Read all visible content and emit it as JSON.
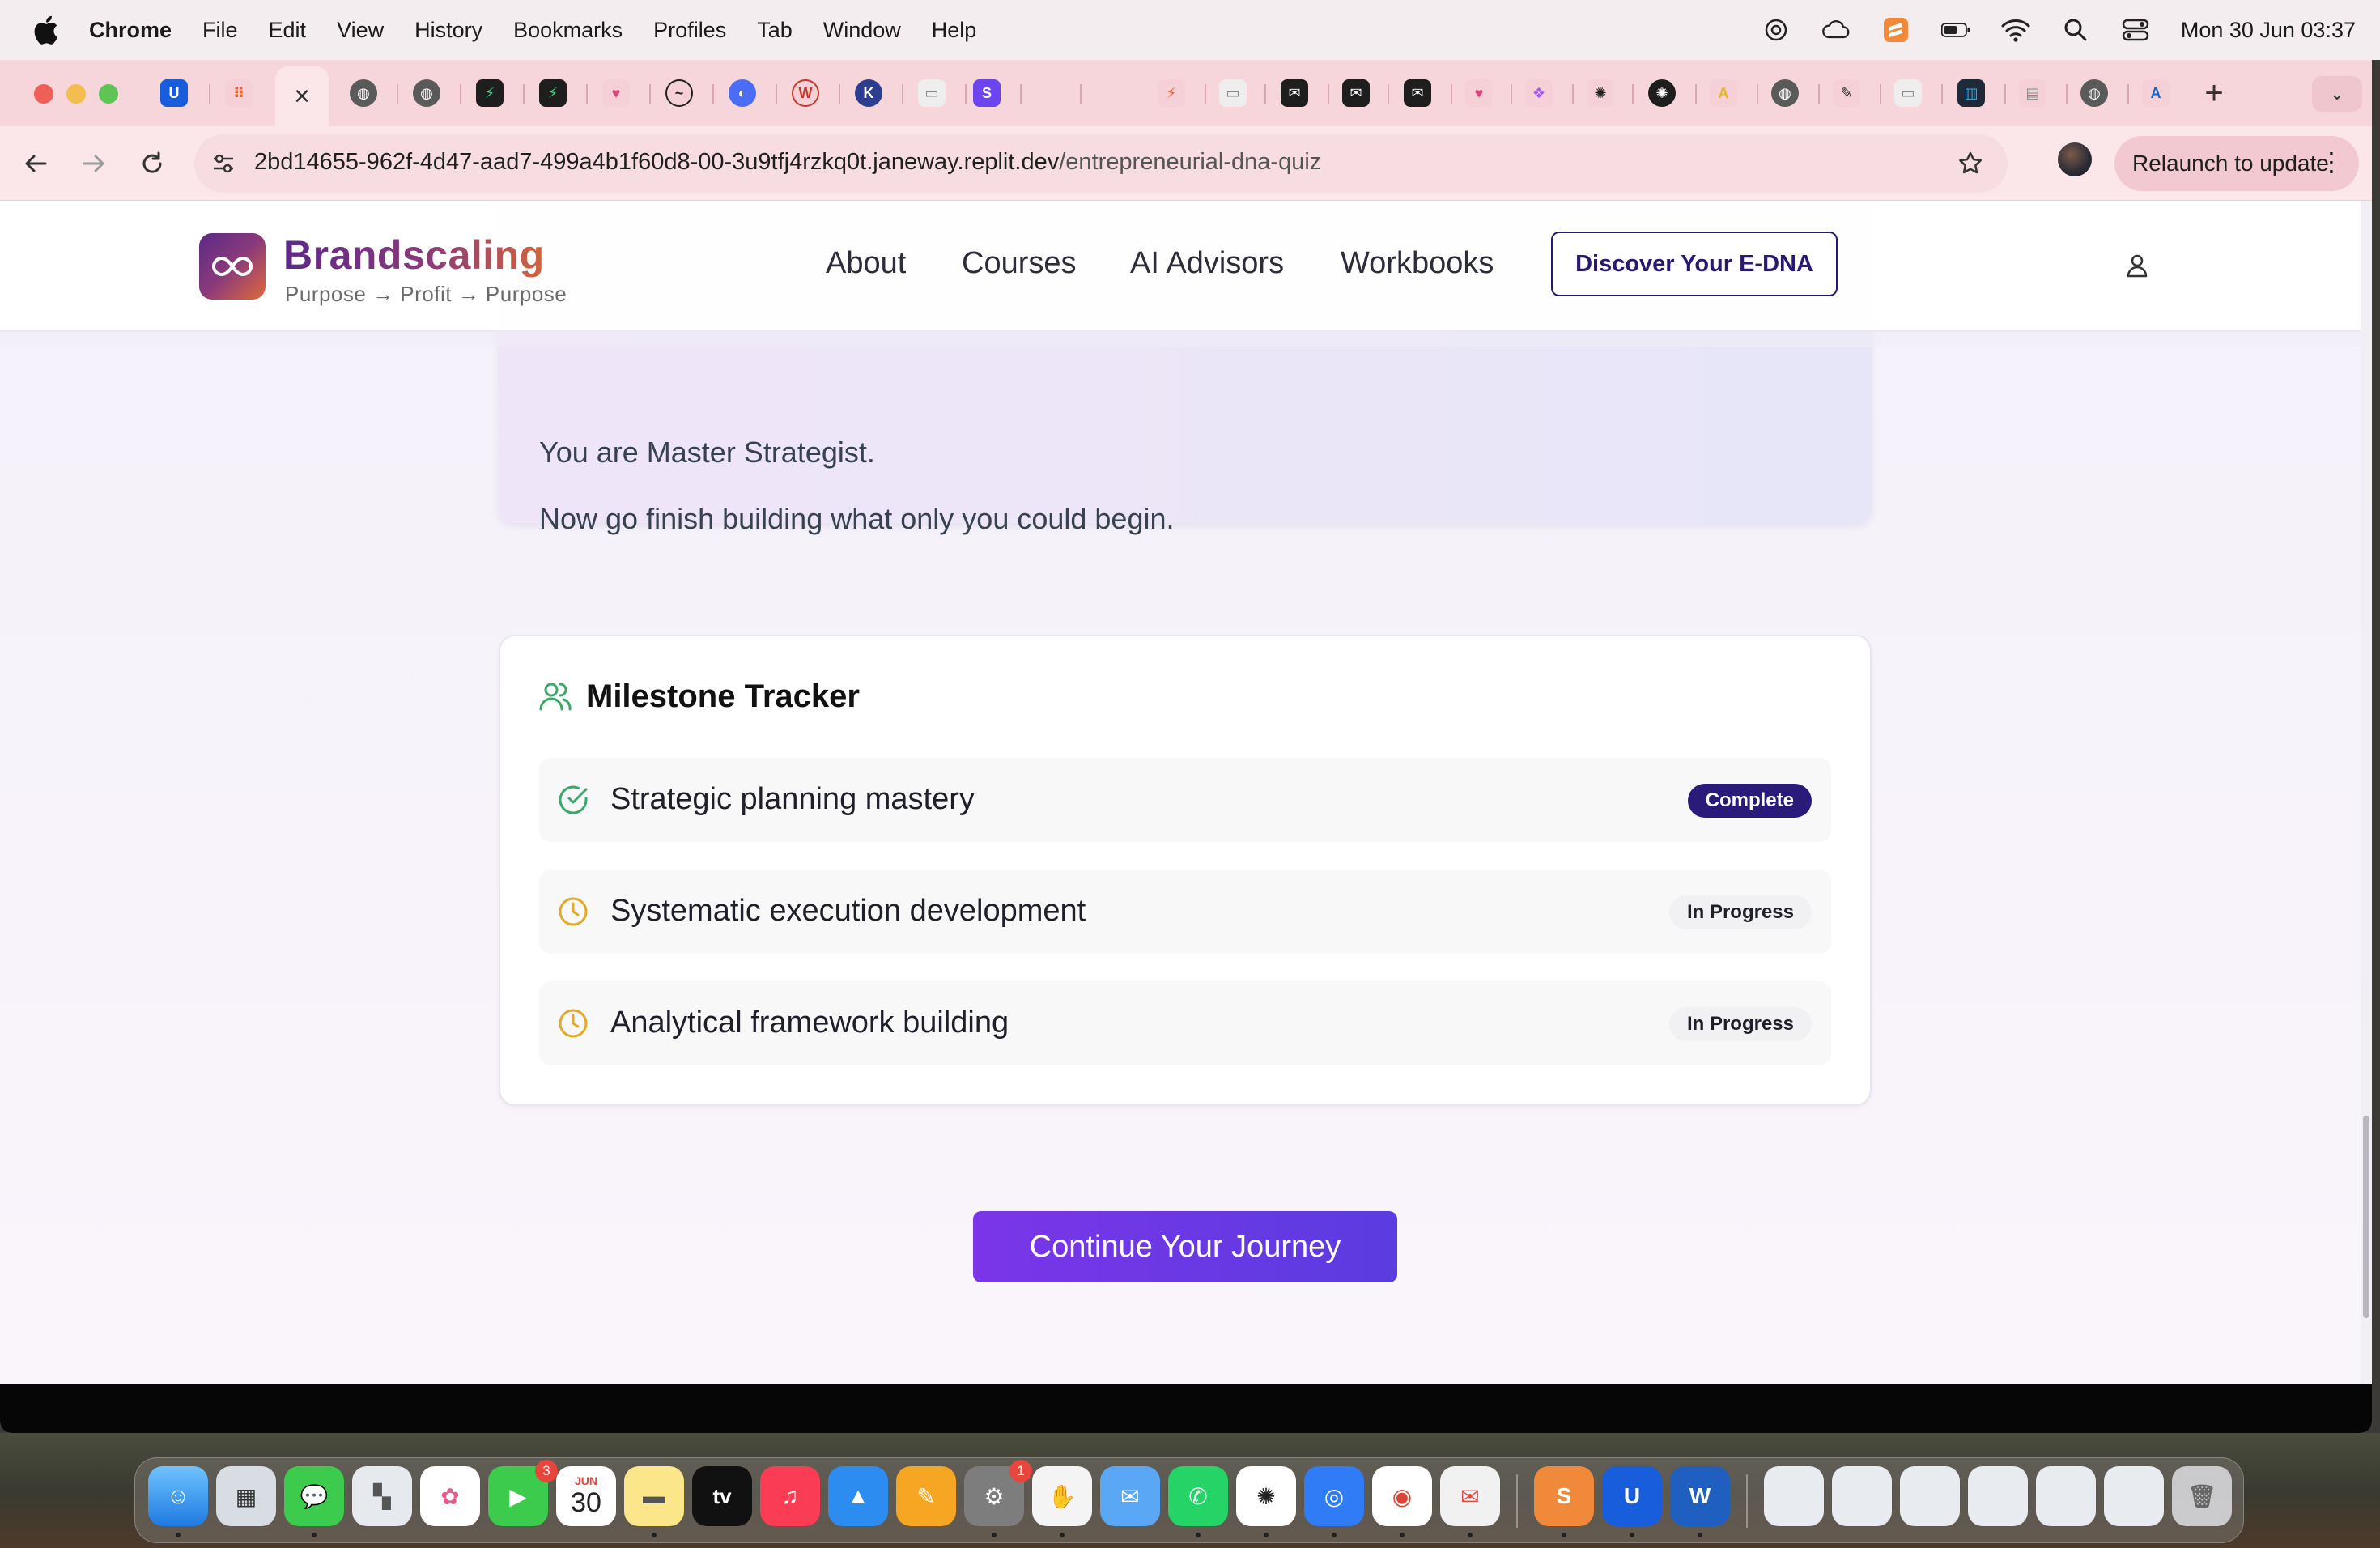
{
  "menubar": {
    "app_name": "Chrome",
    "items": [
      "File",
      "Edit",
      "View",
      "History",
      "Bookmarks",
      "Profiles",
      "Tab",
      "Window",
      "Help"
    ],
    "clock": "Mon 30 Jun  03:37"
  },
  "browser": {
    "url_host": "2bd14655-962f-4d47-aad7-499a4b1f60d8-00-3u9tfj4rzkq0t.janeway.replit.dev",
    "url_path": "/entrepreneurial-dna-quiz",
    "relaunch_label": "Relaunch to update",
    "new_tab_label": "+",
    "close_tab_label": "×"
  },
  "header": {
    "brand_name": "Brandscaling",
    "tagline": "Purpose → Profit → Purpose",
    "nav": {
      "about": "About",
      "courses": "Courses",
      "ai_advisors": "AI Advisors",
      "workbooks": "Workbooks"
    },
    "cta_label": "Discover Your E-DNA"
  },
  "result_card": {
    "line1": "You are Master Strategist.",
    "line2": "Now go finish building what only you could begin."
  },
  "milestones": {
    "title": "Milestone Tracker",
    "items": [
      {
        "label": "Strategic planning mastery",
        "status": "Complete"
      },
      {
        "label": "Systematic execution development",
        "status": "In Progress"
      },
      {
        "label": "Analytical framework building",
        "status": "In Progress"
      }
    ]
  },
  "continue_label": "Continue Your Journey",
  "dock": {
    "calendar_month": "JUN",
    "calendar_day": "30",
    "facetime_badge": "3",
    "settings_badge": "1",
    "tv_label": "tv"
  },
  "colors": {
    "brand_purple": "#5b2a86",
    "brand_orange": "#d2643c",
    "complete_badge": "#2a1a7a",
    "continue_button": "#6a38e6",
    "check_green": "#3aa86b",
    "clock_amber": "#e0a92a"
  }
}
